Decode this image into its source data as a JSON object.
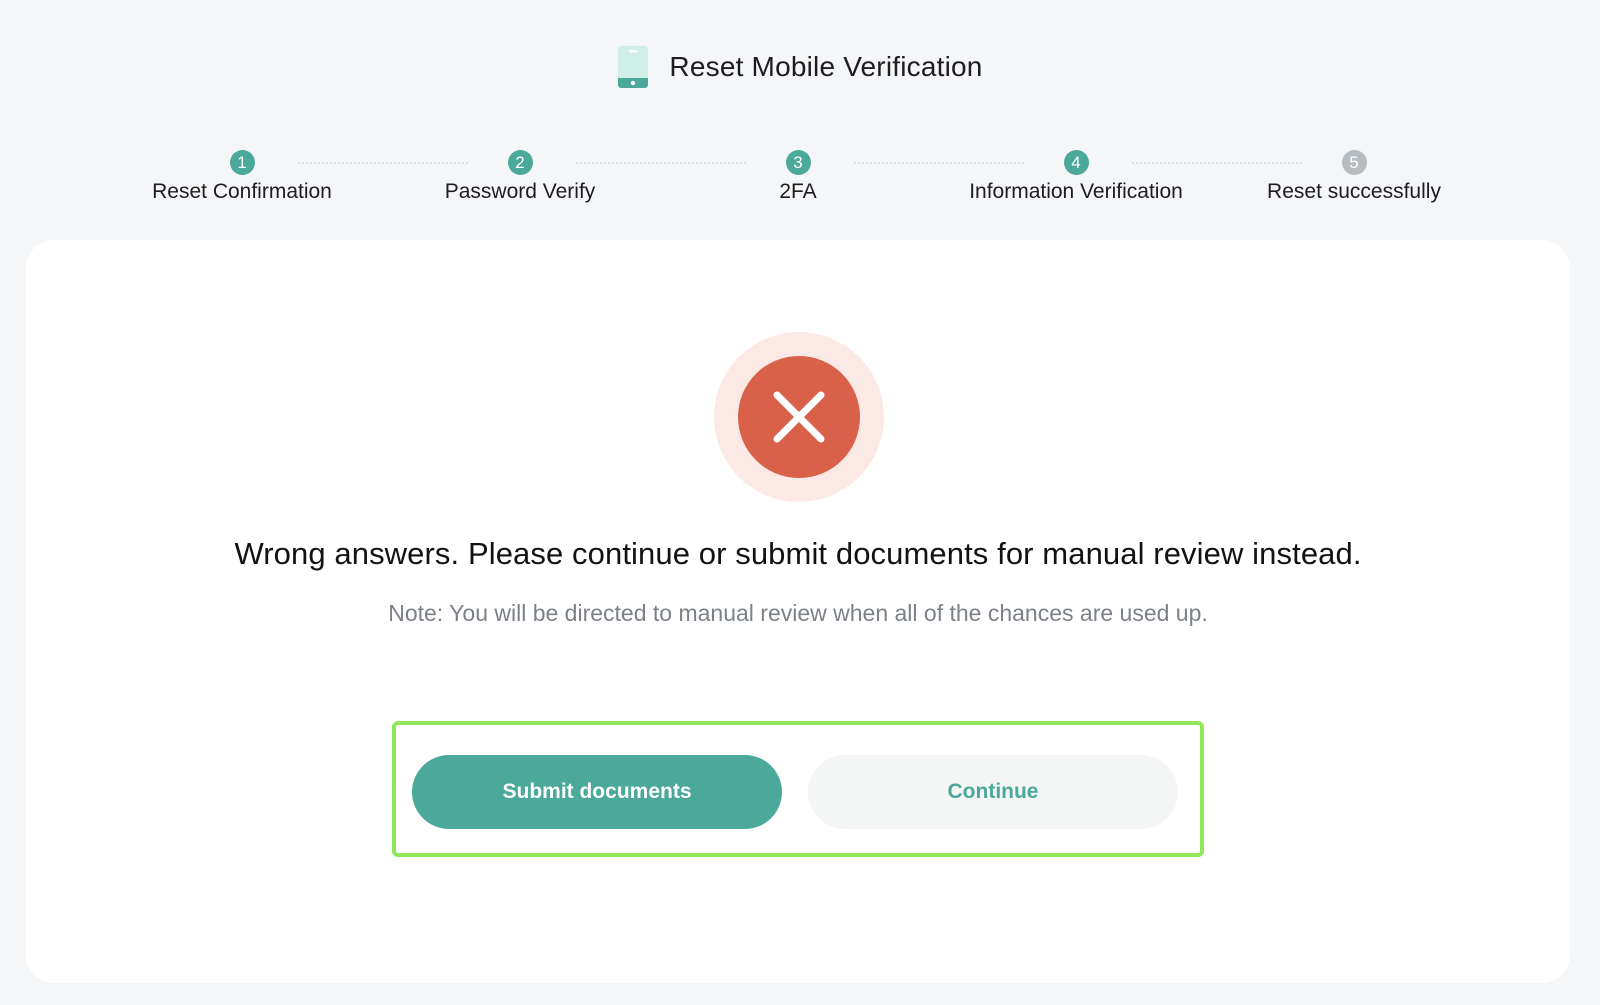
{
  "header": {
    "title": "Reset Mobile Verification",
    "icon": "phone-icon"
  },
  "stepper": {
    "steps": [
      {
        "number": "1",
        "label": "Reset Confirmation",
        "state": "done"
      },
      {
        "number": "2",
        "label": "Password Verify",
        "state": "done"
      },
      {
        "number": "3",
        "label": "2FA",
        "state": "done"
      },
      {
        "number": "4",
        "label": "Information Verification",
        "state": "current"
      },
      {
        "number": "5",
        "label": "Reset successfully",
        "state": "pending"
      }
    ]
  },
  "result": {
    "icon": "error-x-icon",
    "message": "Wrong answers. Please continue or submit documents for manual review instead.",
    "note": "Note: You will be directed to manual review when all of the chances are used up."
  },
  "actions": {
    "submit_label": "Submit documents",
    "continue_label": "Continue"
  },
  "colors": {
    "accent": "#4aa998",
    "error": "#d9614a",
    "error_halo": "#fbe9e6",
    "pending": "#b7bcc0",
    "highlight": "#8ee85a"
  }
}
